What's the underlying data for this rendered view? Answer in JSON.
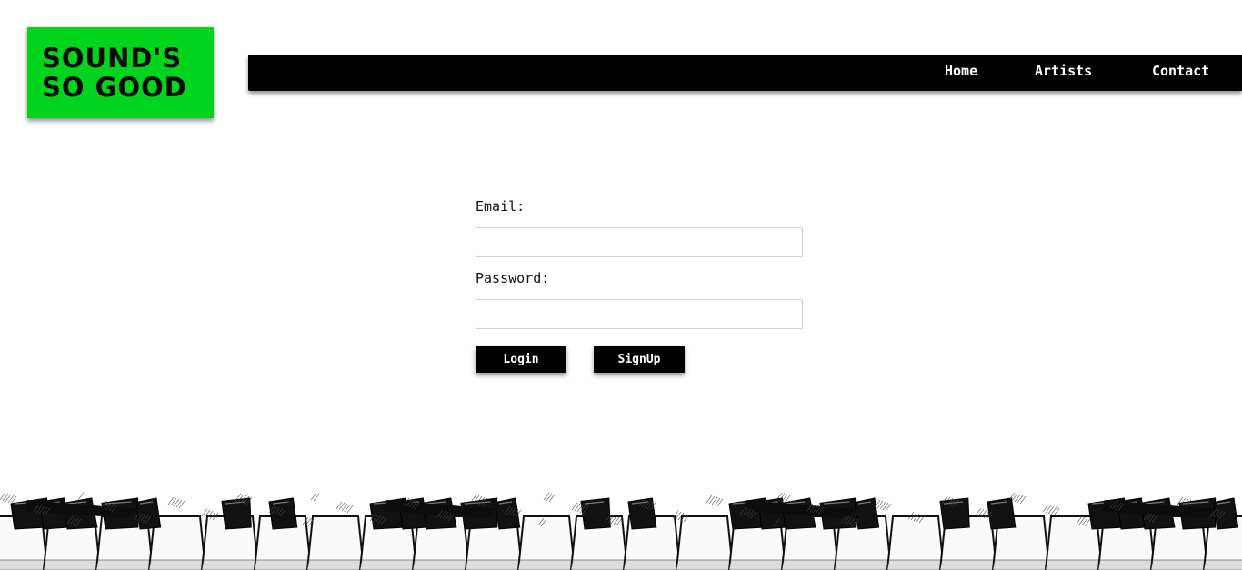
{
  "logo": {
    "line1": "SOUND'S",
    "line2": "SO GOOD",
    "color": "#00d41c"
  },
  "nav": {
    "items": [
      {
        "label": "Home"
      },
      {
        "label": "Artists"
      },
      {
        "label": "Contact"
      }
    ]
  },
  "login_form": {
    "email_label": "Email:",
    "email_value": "",
    "password_label": "Password:",
    "password_value": "",
    "login_label": "Login",
    "signup_label": "SignUp"
  },
  "footer": {
    "decoration": "piano-keys-illustration"
  }
}
